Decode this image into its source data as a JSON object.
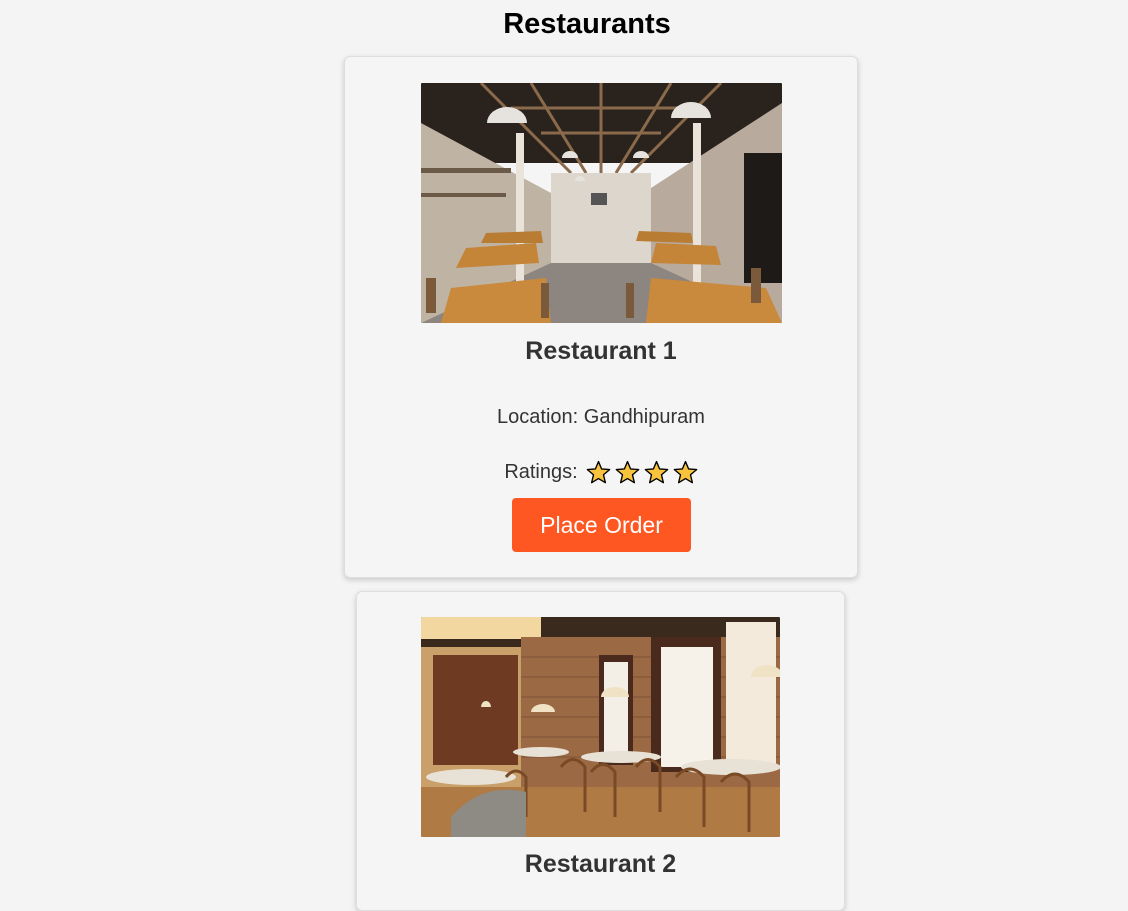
{
  "page": {
    "title": "Restaurants"
  },
  "restaurants": [
    {
      "name": "Restaurant 1",
      "location": "Location: Gandhipuram",
      "ratings_label": "Ratings:",
      "rating": 4,
      "order_label": "Place Order",
      "image_icon": "restaurant-interior-photo"
    },
    {
      "name": "Restaurant 2",
      "image_icon": "restaurant-interior-photo"
    }
  ],
  "colors": {
    "accent": "#ff5722",
    "star_fill": "#f8c33c",
    "background": "#f4f4f4"
  }
}
